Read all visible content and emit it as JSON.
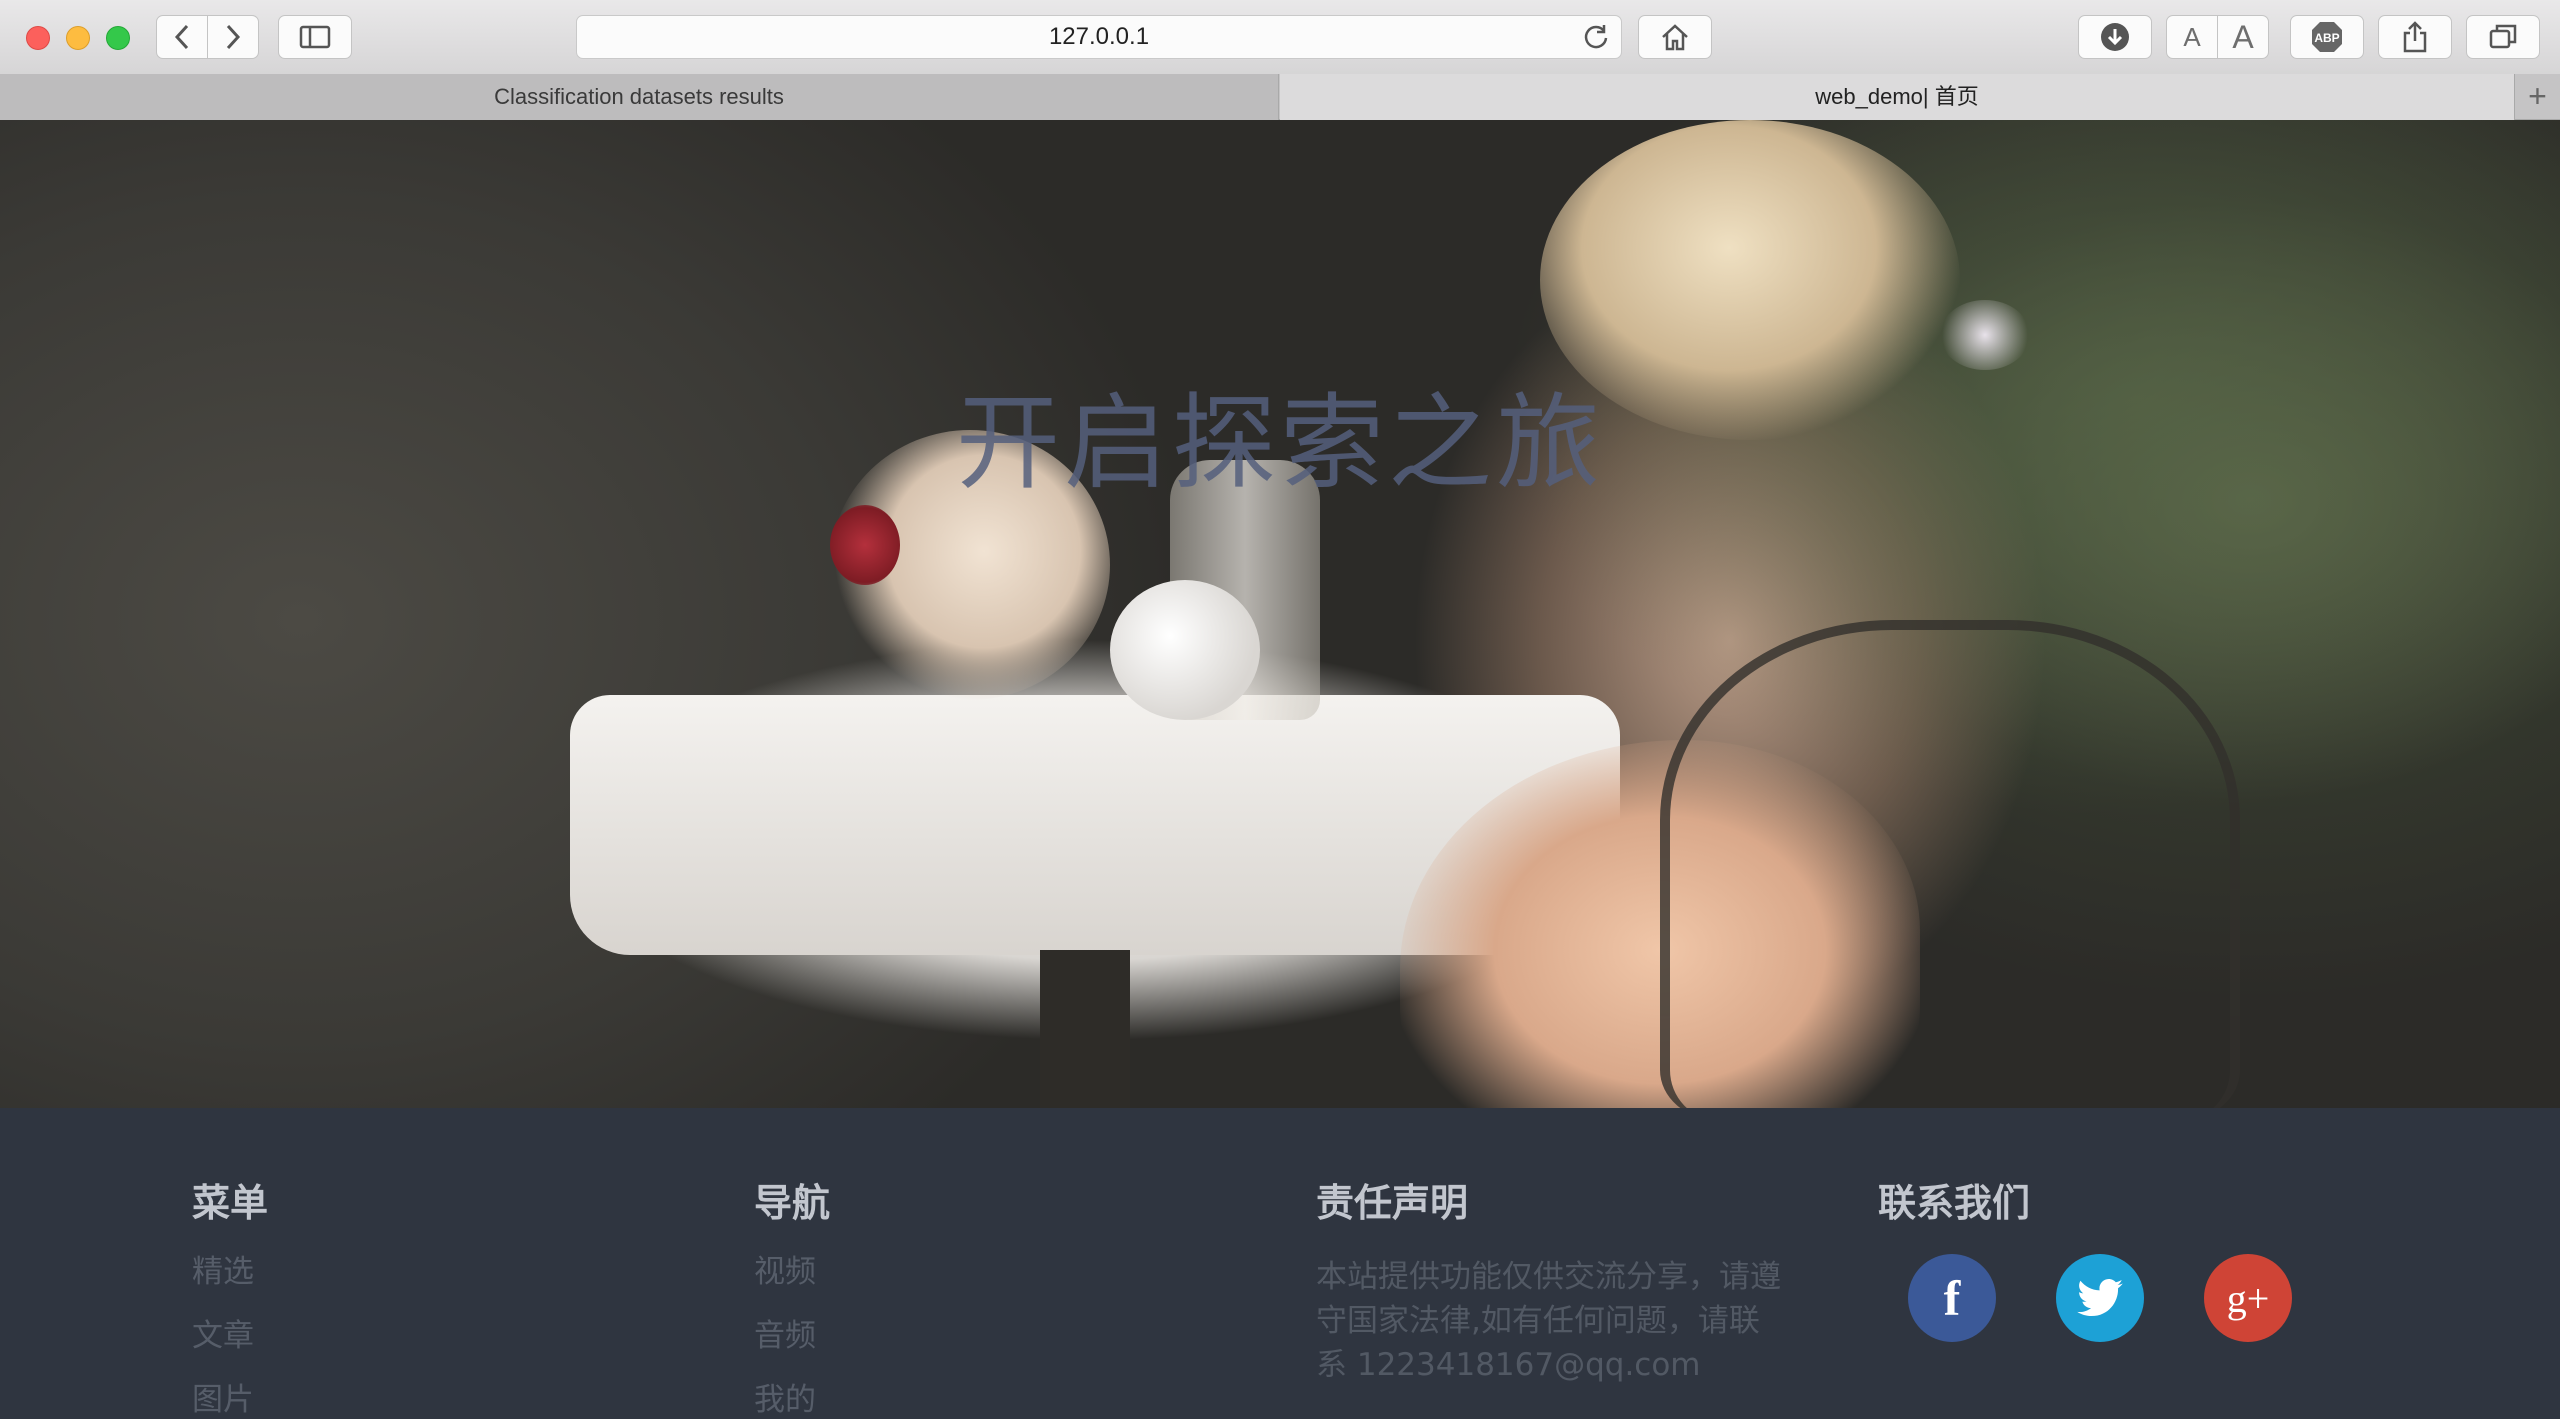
{
  "browser": {
    "url": "127.0.0.1",
    "tabs": [
      {
        "label": "Classification datasets results"
      },
      {
        "label": "web_demo| 首页"
      }
    ],
    "new_tab_label": "+"
  },
  "hero": {
    "title": "开启探索之旅"
  },
  "footer": {
    "menu": {
      "heading": "菜单",
      "links": [
        "精选",
        "文章",
        "图片"
      ]
    },
    "nav": {
      "heading": "导航",
      "links": [
        "视频",
        "音频",
        "我的"
      ]
    },
    "disclaimer": {
      "heading": "责任声明",
      "text": "本站提供功能仅供交流分享，请遵守国家法律,如有任何问题，请联系 1223418167@qq.com"
    },
    "contact": {
      "heading": "联系我们",
      "social": [
        {
          "icon": "facebook-icon",
          "glyph": "f",
          "color": "#3b5998"
        },
        {
          "icon": "twitter-icon",
          "glyph": "",
          "color": "#1da1d6"
        },
        {
          "icon": "google-plus-icon",
          "glyph": "g+",
          "color": "#cf4436"
        }
      ]
    }
  },
  "colors": {
    "footer_bg": "#2f3540",
    "heading": "#c2c6ce",
    "link": "#565d69"
  }
}
